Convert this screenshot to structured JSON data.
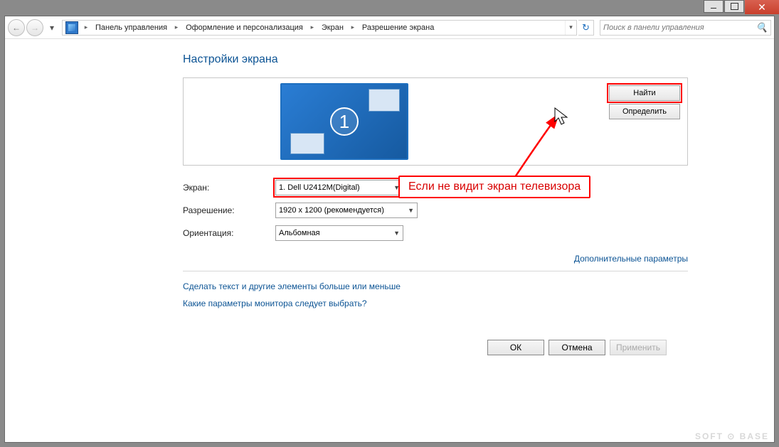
{
  "breadcrumb": {
    "items": [
      "Панель управления",
      "Оформление и персонализация",
      "Экран",
      "Разрешение экрана"
    ]
  },
  "search": {
    "placeholder": "Поиск в панели управления"
  },
  "page": {
    "title": "Настройки экрана"
  },
  "preview": {
    "monitor_number": "1",
    "detect_label": "Найти",
    "identify_label": "Определить"
  },
  "form": {
    "display_label": "Экран:",
    "display_value": "1. Dell U2412M(Digital)",
    "resolution_label": "Разрешение:",
    "resolution_value": "1920 x 1200 (рекомендуется)",
    "orientation_label": "Ориентация:",
    "orientation_value": "Альбомная"
  },
  "links": {
    "advanced": "Дополнительные параметры",
    "text_size": "Сделать текст и другие элементы больше или меньше",
    "which_monitor": "Какие параметры монитора следует выбрать?"
  },
  "buttons": {
    "ok": "ОК",
    "cancel": "Отмена",
    "apply": "Применить"
  },
  "annotation": {
    "text": "Если не видит экран телевизора"
  },
  "watermark": "SOFT ⊙ BASE"
}
